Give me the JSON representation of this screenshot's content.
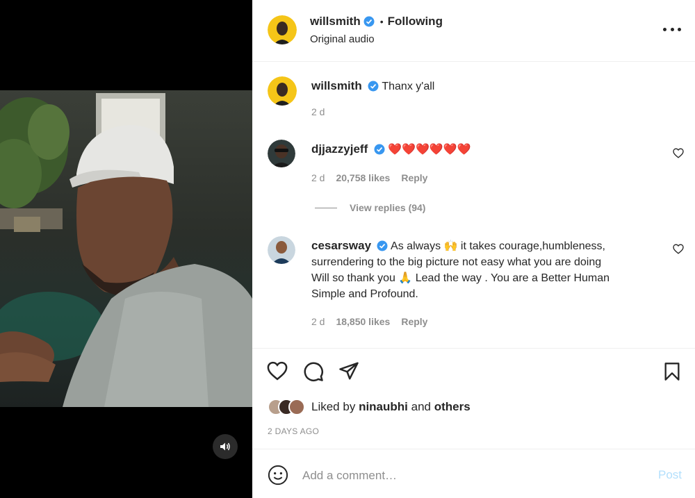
{
  "post": {
    "author": "willsmith",
    "follow_state": "Following",
    "separator": "•",
    "audio": "Original audio"
  },
  "caption": {
    "author": "willsmith",
    "text": "Thanx y'all",
    "time": "2 d"
  },
  "comments": [
    {
      "author": "djjazzyjeff",
      "text": "❤️❤️❤️❤️❤️❤️",
      "time": "2 d",
      "likes": "20,758 likes",
      "reply_label": "Reply",
      "view_replies": "View replies (94)"
    },
    {
      "author": "cesarsway",
      "lines": [
        "As always 🙌 it takes courage,humbleness,",
        "surrendering to the big picture not easy what you are doing",
        "Will so thank you 🙏 Lead the way . You are a Better Human",
        "Simple and Profound."
      ],
      "time": "2 d",
      "likes": "18,850 likes",
      "reply_label": "Reply"
    }
  ],
  "likes": {
    "prefix": "Liked by",
    "user": "nina​ubhi",
    "joiner": "and",
    "others": "others"
  },
  "timestamp": "2 DAYS AGO",
  "composer": {
    "placeholder": "Add a comment…",
    "post_label": "Post"
  },
  "icons": {
    "verified": "verified-badge-icon",
    "more": "more-options-icon",
    "heart": "heart-icon",
    "comment": "comment-icon",
    "share": "share-icon",
    "save": "bookmark-icon",
    "emoji": "emoji-icon",
    "mute": "speaker-icon"
  },
  "colors": {
    "verified": "#3897f0",
    "post_disabled": "#b2dffc",
    "muted_text": "#8e8e8e",
    "avatar_ring": "#f5c518"
  }
}
